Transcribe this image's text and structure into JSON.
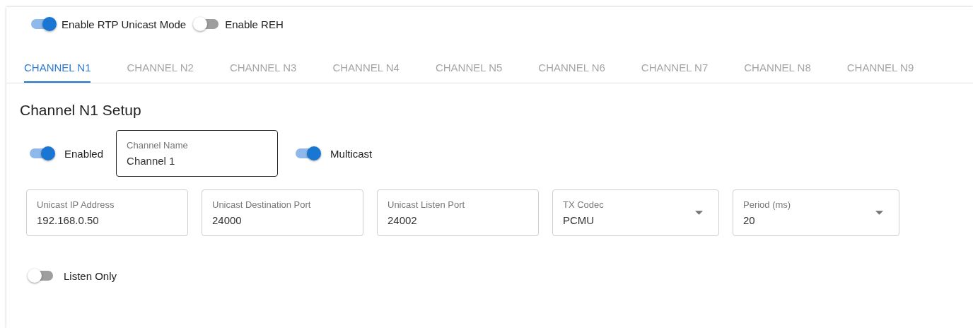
{
  "top_switches": [
    {
      "label": "Enable RTP Unicast Mode",
      "on": true
    },
    {
      "label": "Enable REH",
      "on": false
    }
  ],
  "tabs": [
    {
      "label": "CHANNEL N1",
      "selected": true
    },
    {
      "label": "CHANNEL N2",
      "selected": false
    },
    {
      "label": "CHANNEL N3",
      "selected": false
    },
    {
      "label": "CHANNEL N4",
      "selected": false
    },
    {
      "label": "CHANNEL N5",
      "selected": false
    },
    {
      "label": "CHANNEL N6",
      "selected": false
    },
    {
      "label": "CHANNEL N7",
      "selected": false
    },
    {
      "label": "CHANNEL N8",
      "selected": false
    },
    {
      "label": "CHANNEL N9",
      "selected": false
    }
  ],
  "setup": {
    "title": "Channel N1 Setup",
    "enabled": {
      "label": "Enabled",
      "on": true
    },
    "channel_name": {
      "label": "Channel Name",
      "value": "Channel 1",
      "focused": true
    },
    "multicast": {
      "label": "Multicast",
      "on": true
    },
    "fields": [
      {
        "kind": "text",
        "label": "Unicast IP Address",
        "value": "192.168.0.50"
      },
      {
        "kind": "text",
        "label": "Unicast Destination Port",
        "value": "24000"
      },
      {
        "kind": "text",
        "label": "Unicast Listen Port",
        "value": "24002"
      },
      {
        "kind": "select",
        "label": "TX Codec",
        "value": "PCMU"
      },
      {
        "kind": "select",
        "label": "Period (ms)",
        "value": "20"
      }
    ],
    "listen_only": {
      "label": "Listen Only",
      "on": false
    }
  }
}
